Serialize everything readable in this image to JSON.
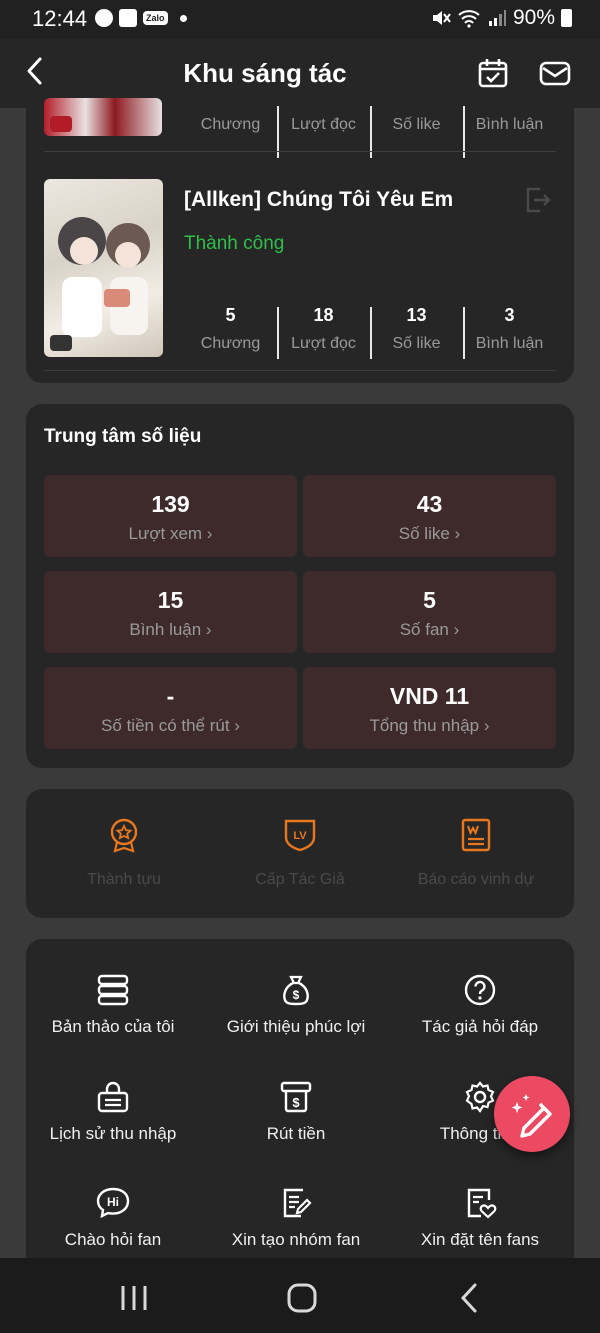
{
  "status_bar": {
    "time": "12:44",
    "zalo": "Zalo",
    "battery": "90%"
  },
  "header": {
    "title": "Khu sáng tác"
  },
  "works": [
    {
      "stats": [
        {
          "value": "",
          "label": "Chương"
        },
        {
          "value": "",
          "label": "Lượt đọc"
        },
        {
          "value": "",
          "label": "Số like"
        },
        {
          "value": "",
          "label": "Bình luận"
        }
      ]
    },
    {
      "title": "[Allken] Chúng Tôi Yêu Em",
      "status": "Thành công",
      "status_color": "#2fbf4a",
      "stats": [
        {
          "value": "5",
          "label": "Chương"
        },
        {
          "value": "18",
          "label": "Lượt đọc"
        },
        {
          "value": "13",
          "label": "Số like"
        },
        {
          "value": "3",
          "label": "Bình luận"
        }
      ]
    }
  ],
  "data_center": {
    "title": "Trung tâm số liệu",
    "tiles": [
      {
        "value": "139",
        "label": "Lượt xem ›"
      },
      {
        "value": "43",
        "label": "Số like ›"
      },
      {
        "value": "15",
        "label": "Bình luận ›"
      },
      {
        "value": "5",
        "label": "Số fan ›"
      },
      {
        "value": "-",
        "label": "Số tiền có thể rút ›"
      },
      {
        "value": "VND 11",
        "label": "Tổng thu nhập ›"
      }
    ]
  },
  "honors": [
    {
      "label": "Thành tựu",
      "icon": "medal-icon"
    },
    {
      "label": "Cấp Tác Giả",
      "icon": "level-badge-icon",
      "badge_text": "LV"
    },
    {
      "label": "Báo cáo vinh dự",
      "icon": "honor-report-icon"
    }
  ],
  "menu": [
    {
      "label": "Bản thảo của tôi",
      "icon": "drafts-stack-icon"
    },
    {
      "label": "Giới thiệu phúc lợi",
      "icon": "money-bag-icon"
    },
    {
      "label": "Tác giả hỏi đáp",
      "icon": "question-icon"
    },
    {
      "label": "Lịch sử thu nhập",
      "icon": "income-history-icon"
    },
    {
      "label": "Rút tiền",
      "icon": "withdraw-icon"
    },
    {
      "label": "Thông tin t",
      "icon": "gear-icon"
    },
    {
      "label": "Chào hỏi fan",
      "icon": "hi-bubble-icon",
      "icon_text": "Hi"
    },
    {
      "label": "Xin tạo nhóm fan",
      "icon": "edit-document-icon"
    },
    {
      "label": "Xin đặt tên fans",
      "icon": "heart-document-icon"
    }
  ],
  "colors": {
    "accent": "#ec4a63",
    "tile_bg": "#3e2a2b",
    "honor_icon": "#e8771e",
    "success": "#2fbf4a"
  }
}
